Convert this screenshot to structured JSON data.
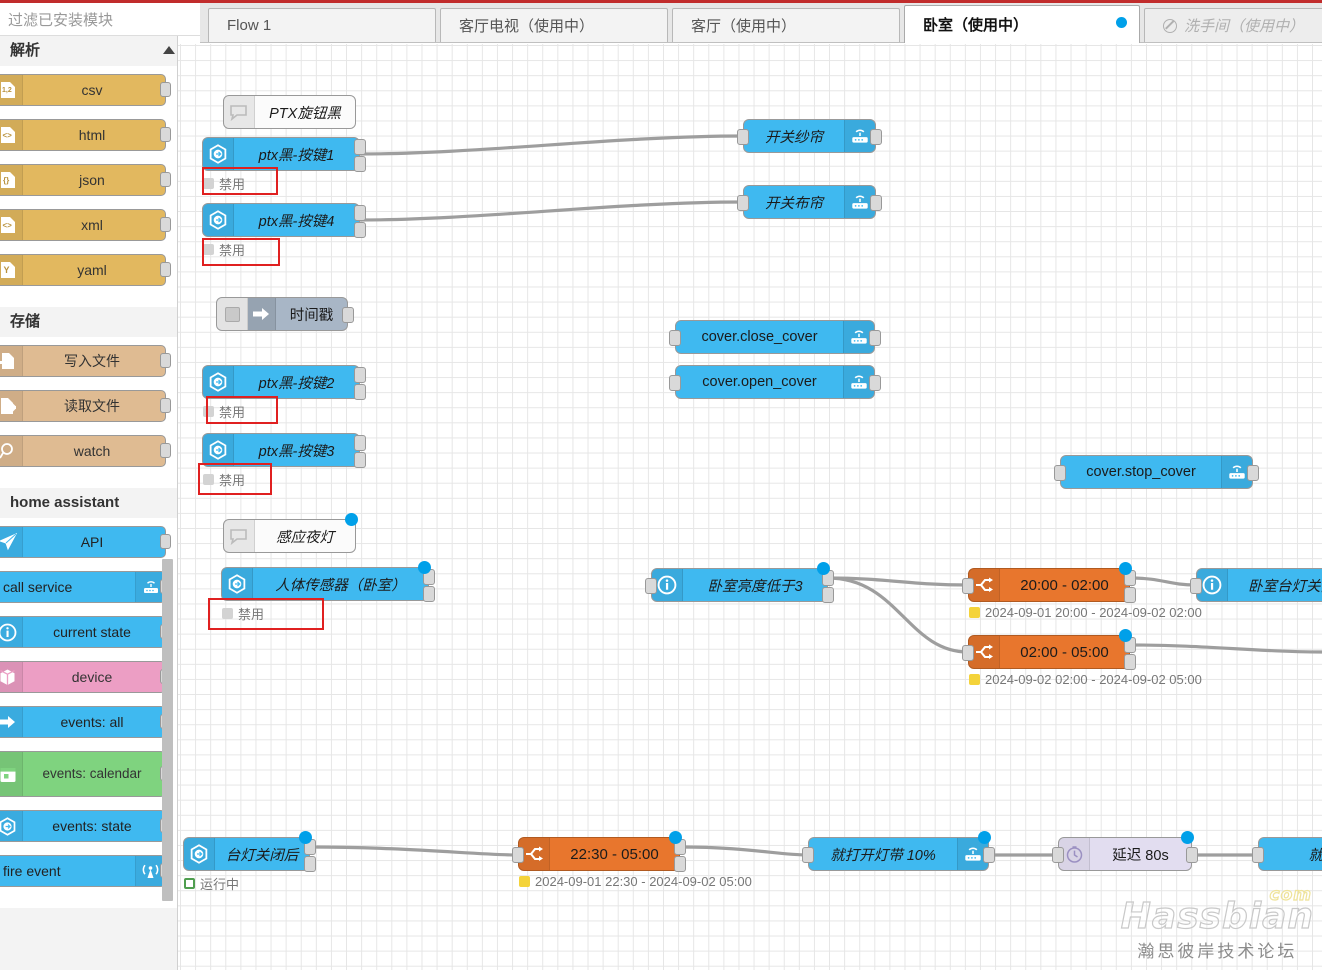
{
  "window": {
    "accent_color": "#c12c2c"
  },
  "palette": {
    "search_placeholder": "过滤已安装模块",
    "categories": [
      {
        "name": "解析",
        "nodes": [
          {
            "label": "csv",
            "icon": "csv-icon",
            "color": "#e2b85f"
          },
          {
            "label": "html",
            "icon": "html-icon",
            "color": "#e2b85f"
          },
          {
            "label": "json",
            "icon": "json-icon",
            "color": "#e2b85f"
          },
          {
            "label": "xml",
            "icon": "xml-icon",
            "color": "#e2b85f"
          },
          {
            "label": "yaml",
            "icon": "yaml-icon",
            "color": "#e2b85f"
          }
        ]
      },
      {
        "name": "存储",
        "nodes": [
          {
            "label": "写入文件",
            "icon": "file-write-icon",
            "color": "#dfbb92"
          },
          {
            "label": "读取文件",
            "icon": "file-read-icon",
            "color": "#dfbb92"
          },
          {
            "label": "watch",
            "icon": "magnifier-icon",
            "color": "#dfbb92"
          }
        ]
      },
      {
        "name": "home assistant",
        "nodes": [
          {
            "label": "API",
            "icon": "paper-plane-icon",
            "color": "#3fb9f0"
          },
          {
            "label": "call service",
            "icon": "router-icon",
            "color": "#3fb9f0"
          },
          {
            "label": "current state",
            "icon": "info-icon",
            "color": "#3fb9f0"
          },
          {
            "label": "device",
            "icon": "cube-icon",
            "color": "#ec9ec4"
          },
          {
            "label": "events: all",
            "icon": "arrow-right-icon",
            "color": "#3fb9f0"
          },
          {
            "label": "events: calendar",
            "icon": "calendar-icon",
            "color": "#7fd37f"
          },
          {
            "label": "events: state",
            "icon": "hexagon-arrow-icon",
            "color": "#3fb9f0"
          },
          {
            "label": "fire event",
            "icon": "broadcast-icon",
            "color": "#3fb9f0"
          }
        ]
      }
    ]
  },
  "tabs": [
    {
      "label": "Flow 1",
      "active": false,
      "disabled": false,
      "dot": false
    },
    {
      "label": "客厅电视（使用中）",
      "active": false,
      "disabled": false,
      "dot": false
    },
    {
      "label": "客厅（使用中）",
      "active": false,
      "disabled": false,
      "dot": false
    },
    {
      "label": "卧室（使用中）",
      "active": true,
      "disabled": false,
      "dot": true
    },
    {
      "label": "洗手间（使用中）",
      "active": false,
      "disabled": true,
      "dot": false
    }
  ],
  "flow": {
    "nodes": [
      {
        "id": "c1",
        "label": "PTX旋钮黑",
        "type": "comment",
        "icon": "comment-icon",
        "color": "#fbfbfb"
      },
      {
        "id": "n1",
        "label": "ptx黑-按键1",
        "type": "events-state",
        "icon": "hexagon-arrow-icon",
        "color": "#3fb9f0",
        "status": "禁用"
      },
      {
        "id": "n2",
        "label": "ptx黑-按键4",
        "type": "events-state",
        "icon": "hexagon-arrow-icon",
        "color": "#3fb9f0",
        "status": "禁用"
      },
      {
        "id": "n3",
        "label": "时间戳",
        "type": "inject",
        "icon": "inject-arrow-icon",
        "color": "#a8b6c6"
      },
      {
        "id": "n4",
        "label": "ptx黑-按键2",
        "type": "events-state",
        "icon": "hexagon-arrow-icon",
        "color": "#3fb9f0",
        "status": "禁用"
      },
      {
        "id": "n5",
        "label": "ptx黑-按键3",
        "type": "events-state",
        "icon": "hexagon-arrow-icon",
        "color": "#3fb9f0",
        "status": "禁用"
      },
      {
        "id": "c2",
        "label": "感应夜灯",
        "type": "comment",
        "icon": "comment-icon",
        "color": "#fbfbfb"
      },
      {
        "id": "n6",
        "label": "人体传感器（卧室）",
        "type": "events-state",
        "icon": "hexagon-arrow-icon",
        "color": "#3fb9f0",
        "status": "禁用"
      },
      {
        "id": "n7",
        "label": "开关纱帘",
        "type": "call-service",
        "icon": "router-icon",
        "color": "#3fb9f0"
      },
      {
        "id": "n8",
        "label": "开关布帘",
        "type": "call-service",
        "icon": "router-icon",
        "color": "#3fb9f0"
      },
      {
        "id": "n9",
        "label": "cover.close_cover",
        "type": "call-service",
        "icon": "router-icon",
        "color": "#3fb9f0"
      },
      {
        "id": "n10",
        "label": "cover.open_cover",
        "type": "call-service",
        "icon": "router-icon",
        "color": "#3fb9f0"
      },
      {
        "id": "n11",
        "label": "cover.stop_cover",
        "type": "call-service",
        "icon": "router-icon",
        "color": "#3fb9f0"
      },
      {
        "id": "n12",
        "label": "卧室亮度低于3",
        "type": "current-state",
        "icon": "info-icon",
        "color": "#3fb9f0"
      },
      {
        "id": "n13",
        "label": "20:00 - 02:00",
        "type": "time-range",
        "icon": "switch-icon",
        "color": "#e8762d",
        "status": "2024-09-01 20:00 - 2024-09-02 02:00"
      },
      {
        "id": "n14",
        "label": "02:00 - 05:00",
        "type": "time-range",
        "icon": "switch-icon",
        "color": "#e8762d",
        "status": "2024-09-02 02:00 - 2024-09-02 05:00"
      },
      {
        "id": "n15",
        "label": "卧室台灯关闭",
        "type": "current-state",
        "icon": "info-icon",
        "color": "#3fb9f0"
      },
      {
        "id": "n16",
        "label": "台灯关闭后",
        "type": "events-state",
        "icon": "hexagon-arrow-icon",
        "color": "#3fb9f0",
        "status": "运行中"
      },
      {
        "id": "n17",
        "label": "22:30 - 05:00",
        "type": "time-range",
        "icon": "switch-icon",
        "color": "#e8762d",
        "status": "2024-09-01 22:30 - 2024-09-02 05:00"
      },
      {
        "id": "n18",
        "label": "就打开灯带 10%",
        "type": "call-service",
        "icon": "router-icon",
        "color": "#3fb9f0"
      },
      {
        "id": "n19",
        "label": "延迟 80s",
        "type": "delay",
        "icon": "stopwatch-icon",
        "color": "#e2ddf0"
      },
      {
        "id": "n20",
        "label": "就关",
        "type": "call-service",
        "icon": "router-icon",
        "color": "#3fb9f0"
      }
    ],
    "disabled_status_label": "禁用",
    "running_status_label": "运行中"
  },
  "watermark": {
    "main": "Hassbian",
    "suffix": "com",
    "sub": "瀚思彼岸技术论坛"
  }
}
